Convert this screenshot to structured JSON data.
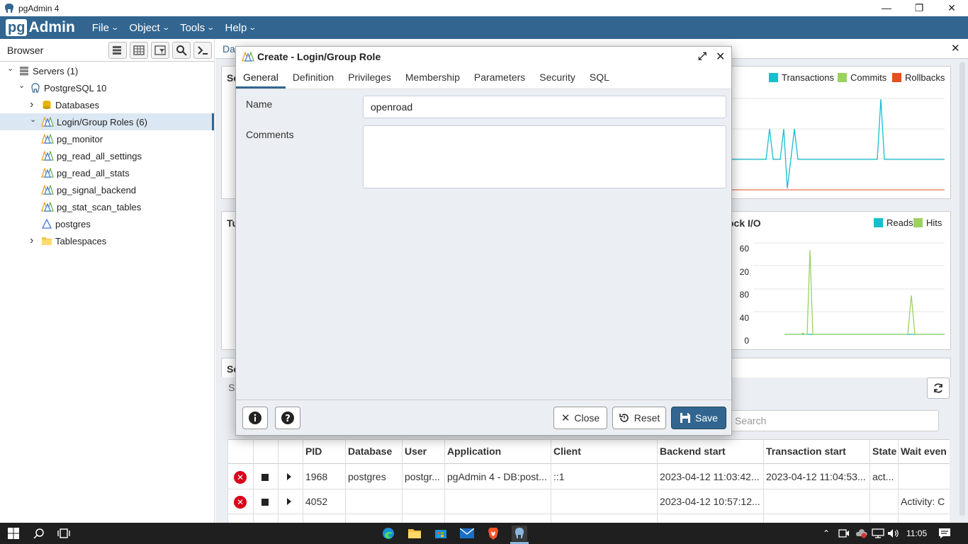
{
  "window": {
    "title": "pgAdmin 4"
  },
  "menubar": {
    "logo_prefix": "pg",
    "logo_suffix": "Admin",
    "items": [
      "File",
      "Object",
      "Tools",
      "Help"
    ]
  },
  "browser": {
    "title": "Browser",
    "tree": [
      {
        "label": "Servers (1)",
        "icon": "server-group-icon",
        "arrow": "expanded"
      },
      {
        "label": "PostgreSQL 10",
        "icon": "elephant-icon",
        "arrow": "expanded"
      },
      {
        "label": "Databases",
        "icon": "database-icon",
        "arrow": "collapsed"
      },
      {
        "label": "Login/Group Roles (6)",
        "icon": "roles-icon",
        "arrow": "expanded",
        "selected": true
      },
      {
        "label": "pg_monitor",
        "icon": "group-role-icon"
      },
      {
        "label": "pg_read_all_settings",
        "icon": "group-role-icon"
      },
      {
        "label": "pg_read_all_stats",
        "icon": "group-role-icon"
      },
      {
        "label": "pg_signal_backend",
        "icon": "group-role-icon"
      },
      {
        "label": "pg_stat_scan_tables",
        "icon": "group-role-icon"
      },
      {
        "label": "postgres",
        "icon": "login-role-icon"
      },
      {
        "label": "Tablespaces",
        "icon": "folder-icon",
        "arrow": "collapsed"
      }
    ]
  },
  "dashboard": {
    "tab_label": "Da",
    "sessions_label": "Se",
    "tuples_label": "Tu",
    "server_activity_label": "Se",
    "server_activity_tab": "S",
    "blockio_title": "ock I/O",
    "tx_legend": [
      {
        "label": "Transactions",
        "color": "#17becf"
      },
      {
        "label": "Commits",
        "color": "#9ad260"
      },
      {
        "label": "Rollbacks",
        "color": "#e4501e"
      }
    ],
    "io_legend": [
      {
        "label": "Reads",
        "color": "#17becf"
      },
      {
        "label": "Hits",
        "color": "#9ad260"
      }
    ],
    "io_ticks": [
      "60",
      "20",
      "80",
      "40",
      "0"
    ],
    "search_placeholder": "Search"
  },
  "dialog": {
    "title": "Create - Login/Group Role",
    "tabs": [
      "General",
      "Definition",
      "Privileges",
      "Membership",
      "Parameters",
      "Security",
      "SQL"
    ],
    "name_label": "Name",
    "name_value": "openroad",
    "comments_label": "Comments",
    "comments_value": "",
    "close_label": "Close",
    "reset_label": "Reset",
    "save_label": "Save"
  },
  "grid": {
    "columns": [
      "PID",
      "Database",
      "User",
      "Application",
      "Client",
      "Backend start",
      "Transaction start",
      "State",
      "Wait even"
    ],
    "rows": [
      [
        "1968",
        "postgres",
        "postgr...",
        "pgAdmin 4 - DB:post...",
        "::1",
        "2023-04-12 11:03:42...",
        "2023-04-12 11:04:53...",
        "act...",
        ""
      ],
      [
        "4052",
        "",
        "",
        "",
        "",
        "2023-04-12 10:57:12...",
        "",
        "",
        "Activity: C"
      ]
    ]
  },
  "taskbar": {
    "time": "11:05"
  }
}
